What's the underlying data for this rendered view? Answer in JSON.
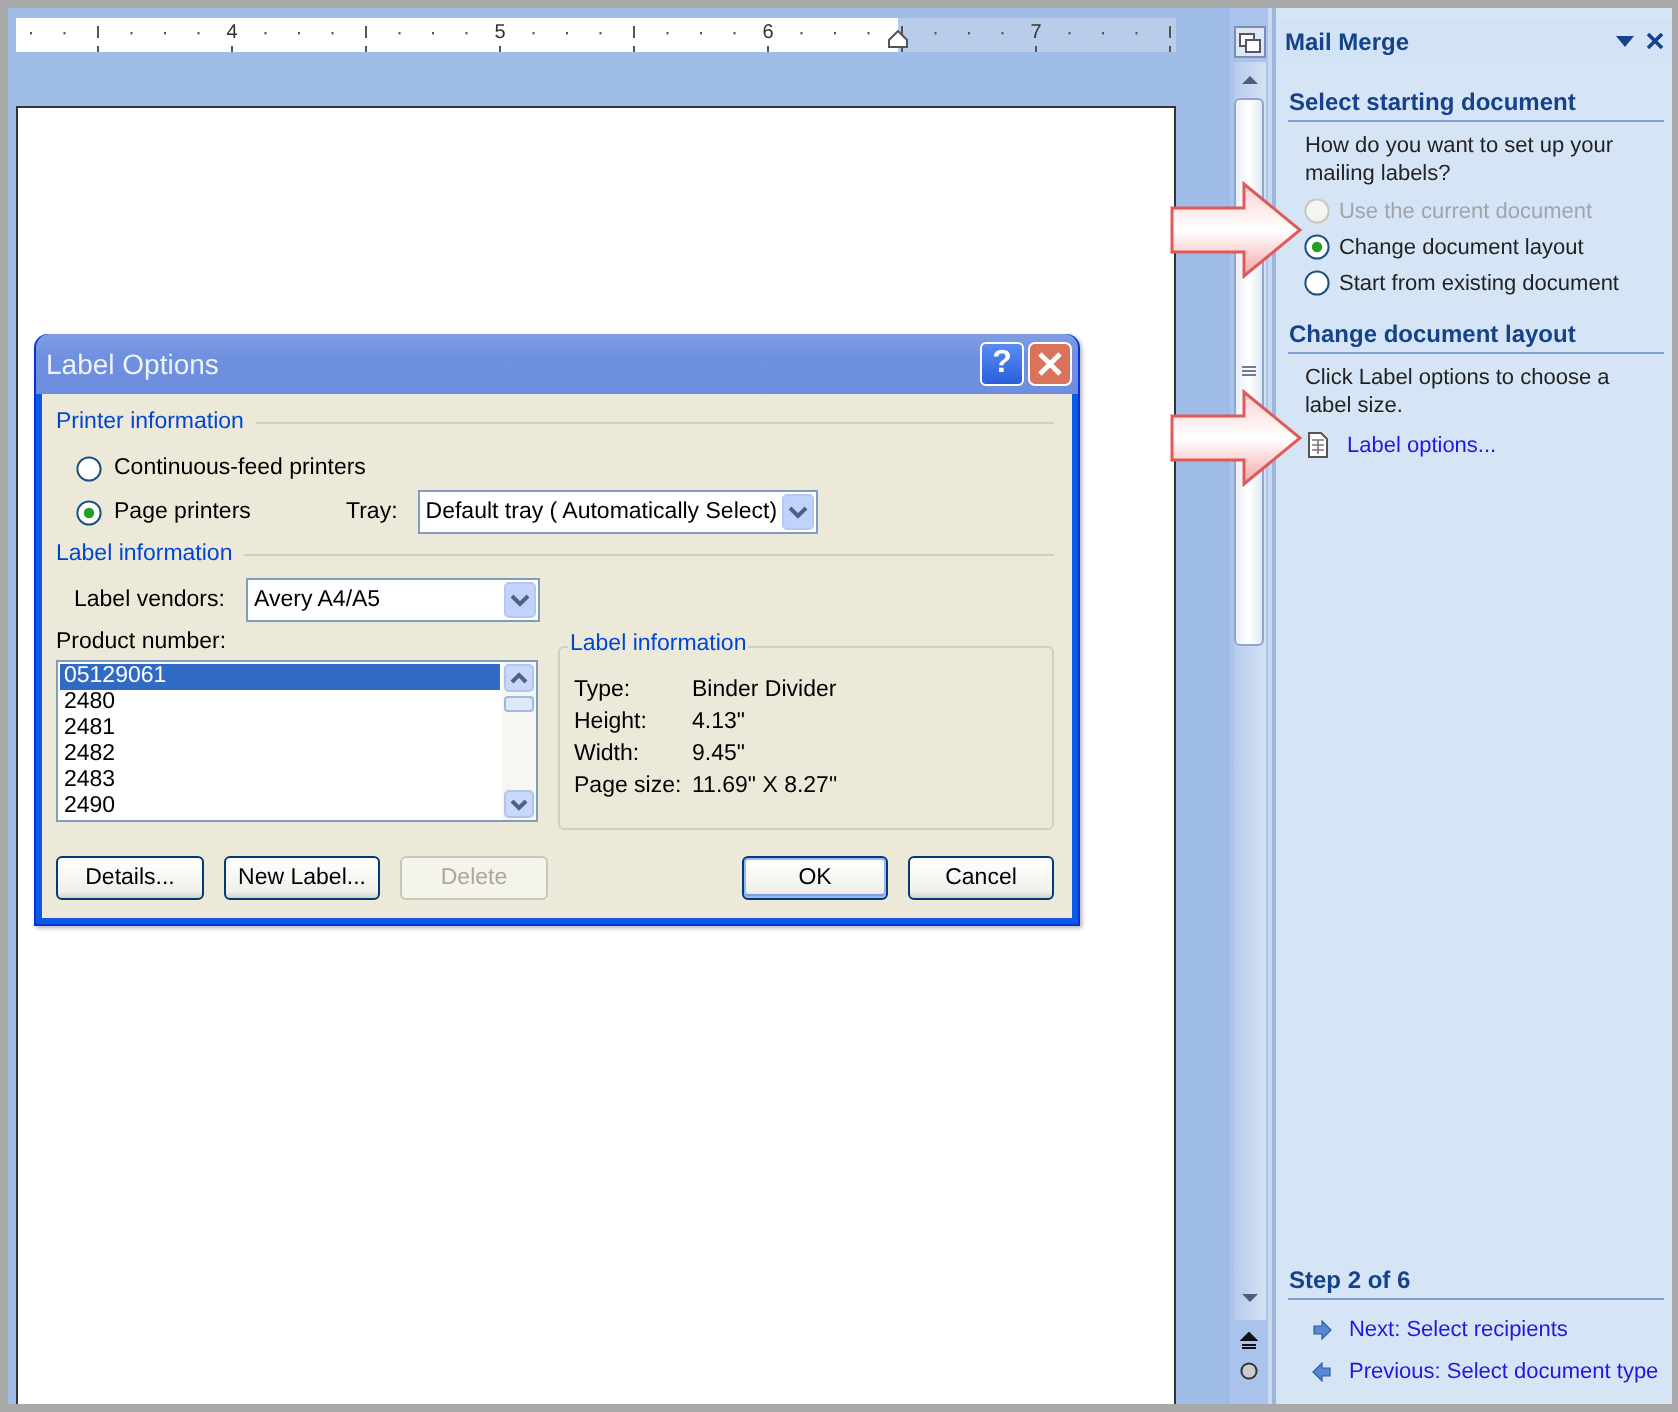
{
  "ruler": {
    "numbers": [
      "4",
      "5",
      "6",
      "7"
    ]
  },
  "dialog": {
    "title": "Label Options",
    "help_button": "?",
    "printer_section": "Printer information",
    "printer_options": [
      {
        "label": "Continuous-feed printers",
        "selected": false
      },
      {
        "label": "Page printers",
        "selected": true
      }
    ],
    "tray": {
      "label": "Tray:",
      "value": "Default tray ( Automatically Select)"
    },
    "label_section": "Label information",
    "vendors": {
      "label": "Label vendors:",
      "value": "Avery A4/A5"
    },
    "product": {
      "label": "Product number:",
      "items": [
        {
          "text": "05129061",
          "selected": true
        },
        {
          "text": "2480",
          "selected": false
        },
        {
          "text": "2481",
          "selected": false
        },
        {
          "text": "2482",
          "selected": false
        },
        {
          "text": "2483",
          "selected": false
        },
        {
          "text": "2490",
          "selected": false
        }
      ]
    },
    "info": {
      "title": "Label information",
      "rows": [
        {
          "key": "Type:",
          "value": "Binder Divider"
        },
        {
          "key": "Height:",
          "value": "4.13\""
        },
        {
          "key": "Width:",
          "value": "9.45\""
        },
        {
          "key": "Page size:",
          "value": "11.69\" X 8.27\""
        }
      ]
    },
    "buttons": [
      {
        "label": "Details...",
        "disabled": false,
        "default": false
      },
      {
        "label": "New Label...",
        "disabled": false,
        "default": false
      },
      {
        "label": "Delete",
        "disabled": true,
        "default": false
      },
      {
        "label": "OK",
        "disabled": false,
        "default": true
      },
      {
        "label": "Cancel",
        "disabled": false,
        "default": false
      }
    ]
  },
  "pane": {
    "title": "Mail Merge",
    "section1": "Select starting document",
    "prompt": "How do you want to set up your mailing labels?",
    "options": [
      {
        "label": "Use the current document",
        "selected": false,
        "disabled": true
      },
      {
        "label": "Change document layout",
        "selected": true,
        "disabled": false
      },
      {
        "label": "Start from existing document",
        "selected": false,
        "disabled": false
      }
    ],
    "section2": "Change document layout",
    "instruction": "Click Label options to choose a label size.",
    "link": "Label options...",
    "step": "Step 2 of 6",
    "nav": [
      {
        "kind": "next",
        "label": "Next: Select recipients"
      },
      {
        "kind": "previous",
        "label": "Previous: Select document type"
      }
    ]
  }
}
